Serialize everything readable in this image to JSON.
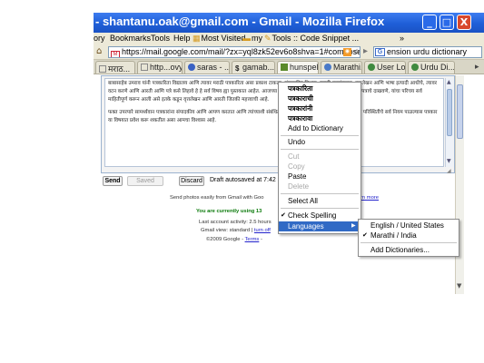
{
  "window": {
    "title": "- shantanu.oak@gmail.com - Gmail - Mozilla Firefox",
    "controls": {
      "minimize": "_",
      "maximize": "□",
      "close": "X"
    }
  },
  "menubar": {
    "items": [
      "ory",
      "Bookmarks",
      "Tools",
      "Help",
      "Most Visited",
      "my",
      "Tools :: Code Snippet ..."
    ],
    "overflow": "»"
  },
  "navbar": {
    "url": "https://mail.google.com/mail/?zx=yql8zk52ev6o8shva=1#compose",
    "search_text": "ension urdu dictionary",
    "search_engine_letter": "G"
  },
  "tabs": [
    {
      "label": "मराठ..."
    },
    {
      "label": "http...ovy"
    },
    {
      "label": "saras - ..."
    },
    {
      "label": "gamab..."
    },
    {
      "label": "hunspel..."
    },
    {
      "label": "Marathi..."
    },
    {
      "label": "User Lo..."
    },
    {
      "label": "Urdu Di..."
    }
  ],
  "compose": {
    "para1": "बाबासाहेब उमराव यांनी पत्रकारिता विद्यालय आणि त्यावर मराठी पत्रकारिता असा प्रकाश टाकला. संपादकीय विभाग, मराठी वृत्तसंकलन, वृत्तलेखन आणि भाषा इत्यादी आधीचे, त्यावर वटन करणे आणि आरती आणि पत्रे कसे लिहावे हे हे सर्व विषय ह्या पुस्तकात आहेत. आजच्या काळात, प्रेस्क्राइब आणि बातमीचे स्वरूप, वृत्तपत्राचे दाखवणे, यांचा परिचय सर्व माहितीपूर्ण करून आली असे इतके कडून वृत्तलेखन आणि आरती जितकी महत्त्वाची आहे.",
    "para2": "फक्त उपरपारे सामर्थ्यवान पत्रकारांना संपादकीय आणि आपण करतात आणि त्यांच्याशी संबंधित अनेक गोष्टी तपासल्या जातात. पत्रकारितेच्या परिस्थितीचे सर्व नियम पाळल्यास पत्रकार या विषयात प्रवेश करू शकतील असा आमचा विश्वास आहे."
  },
  "actions": {
    "send": "Send",
    "saved": "Saved",
    "discard": "Discard",
    "autosave": "Draft autosaved at 7:42 PM"
  },
  "footer": {
    "photos_text": "Send photos easily from Gmail with Goo",
    "learn_more": "rn more",
    "using_text": "You are currently using 13",
    "activity_text": "Last account activity: 2.5 hours",
    "view_prefix": "Gmail view: standard |",
    "view_link": "turn off",
    "copy_prefix": "©2009 Google -",
    "copy_link": "Terms",
    "copy_suffix": "-"
  },
  "context_menu": {
    "suggestions": [
      "पत्रकारिता",
      "पत्रकाराची",
      "पत्रकारांनी",
      "पत्रकारावा"
    ],
    "add_to_dictionary": "Add to Dictionary",
    "undo": "Undo",
    "cut": "Cut",
    "copy": "Copy",
    "paste": "Paste",
    "delete": "Delete",
    "select_all": "Select All",
    "check_spelling": "Check Spelling",
    "languages": "Languages"
  },
  "languages_submenu": {
    "options": [
      "English / United States",
      "Marathi / India"
    ],
    "selected": "Marathi / India",
    "add_dictionaries": "Add Dictionaries..."
  },
  "colors": {
    "titlebar": "#1f5fd8",
    "menu_highlight": "#316ac5",
    "close_button": "#d8482c",
    "gmail_green_text": "#0b7a0b",
    "link_blue": "#2222cc"
  }
}
